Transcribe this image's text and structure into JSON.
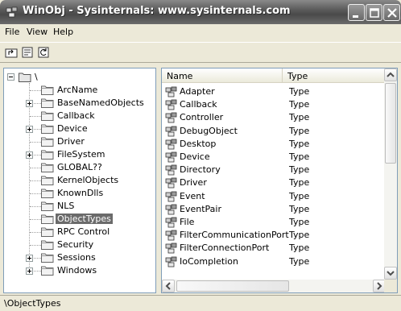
{
  "window": {
    "title": "WinObj - Sysinternals: www.sysinternals.com",
    "app_icon": "winobj-app-icon"
  },
  "menu": [
    "File",
    "View",
    "Help"
  ],
  "toolbar": [
    "up-folder-icon",
    "properties-icon",
    "refresh-icon"
  ],
  "tree": {
    "root": "\\",
    "items": [
      {
        "label": "ArcName",
        "expandable": false
      },
      {
        "label": "BaseNamedObjects",
        "expandable": true
      },
      {
        "label": "Callback",
        "expandable": false
      },
      {
        "label": "Device",
        "expandable": true
      },
      {
        "label": "Driver",
        "expandable": false
      },
      {
        "label": "FileSystem",
        "expandable": true
      },
      {
        "label": "GLOBAL??",
        "expandable": false
      },
      {
        "label": "KernelObjects",
        "expandable": false
      },
      {
        "label": "KnownDlls",
        "expandable": false
      },
      {
        "label": "NLS",
        "expandable": false
      },
      {
        "label": "ObjectTypes",
        "expandable": false,
        "selected": true
      },
      {
        "label": "RPC Control",
        "expandable": false
      },
      {
        "label": "Security",
        "expandable": false
      },
      {
        "label": "Sessions",
        "expandable": true
      },
      {
        "label": "Windows",
        "expandable": true
      }
    ]
  },
  "list": {
    "columns": [
      "Name",
      "Type"
    ],
    "rows": [
      {
        "name": "Adapter",
        "type": "Type"
      },
      {
        "name": "Callback",
        "type": "Type"
      },
      {
        "name": "Controller",
        "type": "Type"
      },
      {
        "name": "DebugObject",
        "type": "Type"
      },
      {
        "name": "Desktop",
        "type": "Type"
      },
      {
        "name": "Device",
        "type": "Type"
      },
      {
        "name": "Directory",
        "type": "Type"
      },
      {
        "name": "Driver",
        "type": "Type"
      },
      {
        "name": "Event",
        "type": "Type"
      },
      {
        "name": "EventPair",
        "type": "Type"
      },
      {
        "name": "File",
        "type": "Type"
      },
      {
        "name": "FilterCommunicationPort",
        "type": "Type"
      },
      {
        "name": "FilterConnectionPort",
        "type": "Type"
      },
      {
        "name": "IoCompletion",
        "type": "Type"
      }
    ]
  },
  "status": {
    "text": "\\ObjectTypes"
  }
}
